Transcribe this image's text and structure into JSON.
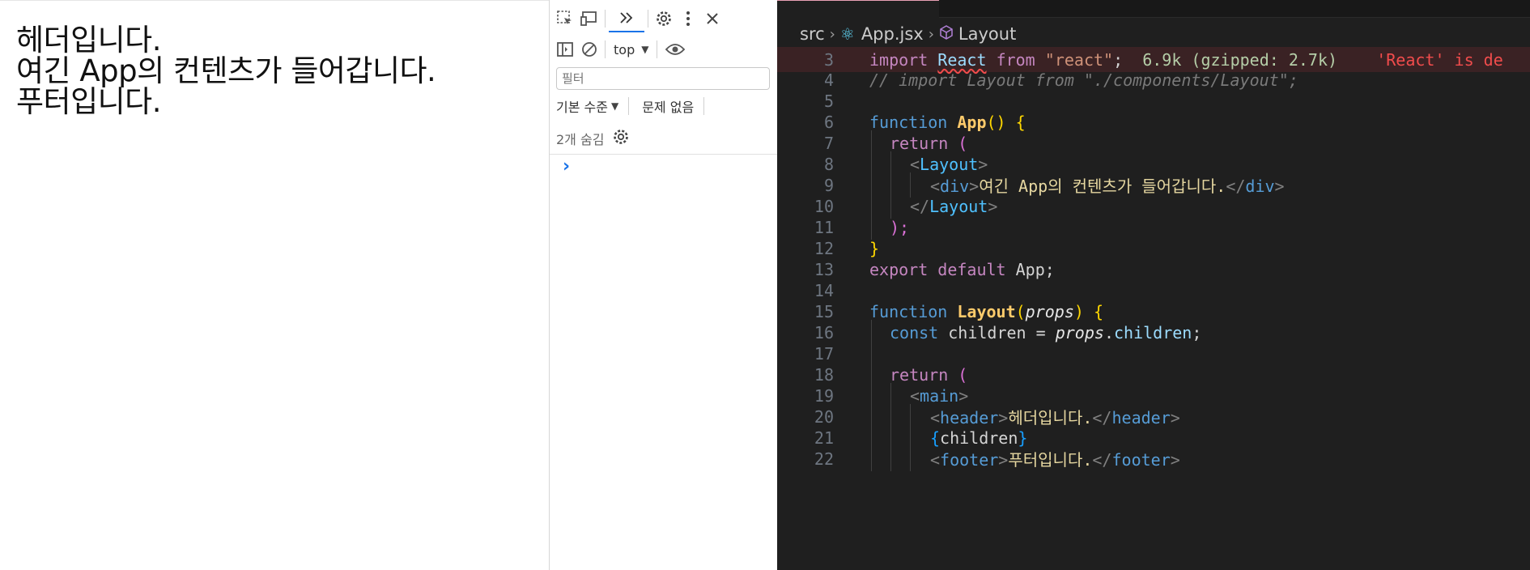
{
  "page": {
    "lines": [
      "헤더입니다.",
      "여긴 App의 컨텐츠가 들어갑니다.",
      "푸터입니다."
    ]
  },
  "devtools": {
    "context": "top",
    "filter_placeholder": "필터",
    "log_level": "기본 수준",
    "issues": "문제 없음",
    "hidden_count": "2개 숨김",
    "prompt": "›"
  },
  "editor": {
    "breadcrumb": {
      "folder": "src",
      "file": "App.jsx",
      "symbol": "Layout"
    },
    "inline_hint": "6.9k (gzipped: 2.7k)",
    "inline_error": "'React' is de",
    "line_numbers": [
      "3",
      "4",
      "5",
      "6",
      "7",
      "8",
      "9",
      "10",
      "11",
      "12",
      "13",
      "14",
      "15",
      "16",
      "17",
      "18",
      "19",
      "20",
      "21",
      "22"
    ],
    "code": {
      "l3": {
        "import": "import",
        "react": "React",
        "from": "from",
        "str": "\"react\"",
        "semi": ";"
      },
      "l4": "// import Layout from \"./components/Layout\";",
      "l6": {
        "kw": "function",
        "name": "App",
        "open": "() {"
      },
      "l7": {
        "kw": "return",
        "paren": "("
      },
      "l8": {
        "tag": "Layout"
      },
      "l9": {
        "tag": "div",
        "text": "여긴 App의 컨텐츠가 들어갑니다."
      },
      "l10": {
        "tag": "Layout"
      },
      "l11": ");",
      "l12": "}",
      "l13": {
        "export": "export",
        "default": "default",
        "name": "App;"
      },
      "l15": {
        "kw": "function",
        "name": "Layout",
        "param": "props",
        "close": ") {"
      },
      "l16": {
        "kw": "const",
        "var": "children",
        "eq": " = ",
        "obj": "props",
        "prop": "children"
      },
      "l18": {
        "kw": "return",
        "paren": "("
      },
      "l19": {
        "tag": "main"
      },
      "l20": {
        "tag": "header",
        "text": "헤더입니다."
      },
      "l21": {
        "var": "children"
      },
      "l22": {
        "tag": "footer",
        "text": "푸터입니다."
      }
    }
  },
  "colors": {
    "editor_bg": "#1f1f1f",
    "keyword": "#c586c0",
    "function": "#ffcb6b",
    "string": "#ce9178",
    "tag": "#4fc1ff",
    "error": "#f14c4c"
  }
}
